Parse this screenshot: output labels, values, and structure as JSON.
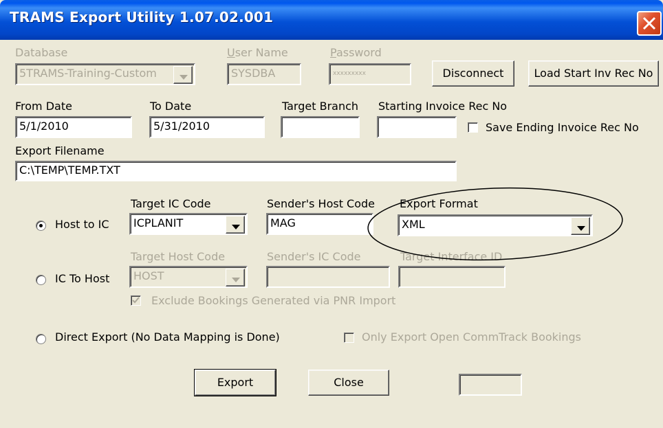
{
  "window": {
    "title": "TRAMS Export Utility 1.07.02.001"
  },
  "connection": {
    "database_label": "Database",
    "database_value": "5TRAMS-Training-Custom",
    "username_label": "User Name",
    "username_value": "SYSDBA",
    "password_label": "Password",
    "password_value": "xxxxxxxxx",
    "disconnect_label": "Disconnect",
    "load_start_label": "Load Start Inv Rec No"
  },
  "range": {
    "from_label": "From Date",
    "from_value": "5/1/2010",
    "to_label": "To Date",
    "to_value": "5/31/2010",
    "branch_label": "Target Branch",
    "branch_value": "",
    "start_inv_label": "Starting Invoice Rec No",
    "start_inv_value": "",
    "save_ending_label": "Save Ending Invoice Rec No"
  },
  "export_file": {
    "label": "Export Filename",
    "value": "C:\\TEMP\\TEMP.TXT"
  },
  "host_to_ic": {
    "radio_label": "Host to IC",
    "selected": true,
    "target_ic_label": "Target IC Code",
    "target_ic_value": "ICPLANIT",
    "sender_host_label": "Sender's Host Code",
    "sender_host_value": "MAG",
    "format_label": "Export Format",
    "format_value": "XML"
  },
  "ic_to_host": {
    "radio_label": "IC To Host",
    "selected": false,
    "target_host_label": "Target Host Code",
    "target_host_value": "HOST",
    "sender_ic_label": "Sender's IC Code",
    "sender_ic_value": "",
    "interface_id_label": "Target Interface ID",
    "interface_id_value": "",
    "exclude_label": "Exclude Bookings Generated via PNR Import",
    "exclude_checked": true
  },
  "direct_export": {
    "radio_label": "Direct Export (No Data Mapping is Done)",
    "selected": false,
    "only_open_label": "Only Export Open CommTrack Bookings"
  },
  "actions": {
    "export_label": "Export",
    "close_label": "Close",
    "status_value": ""
  },
  "colors": {
    "title_bar": "#0058ee",
    "dialog_bg": "#ece9d8",
    "disabled_text": "#aca899",
    "close_button": "#e0522e"
  }
}
